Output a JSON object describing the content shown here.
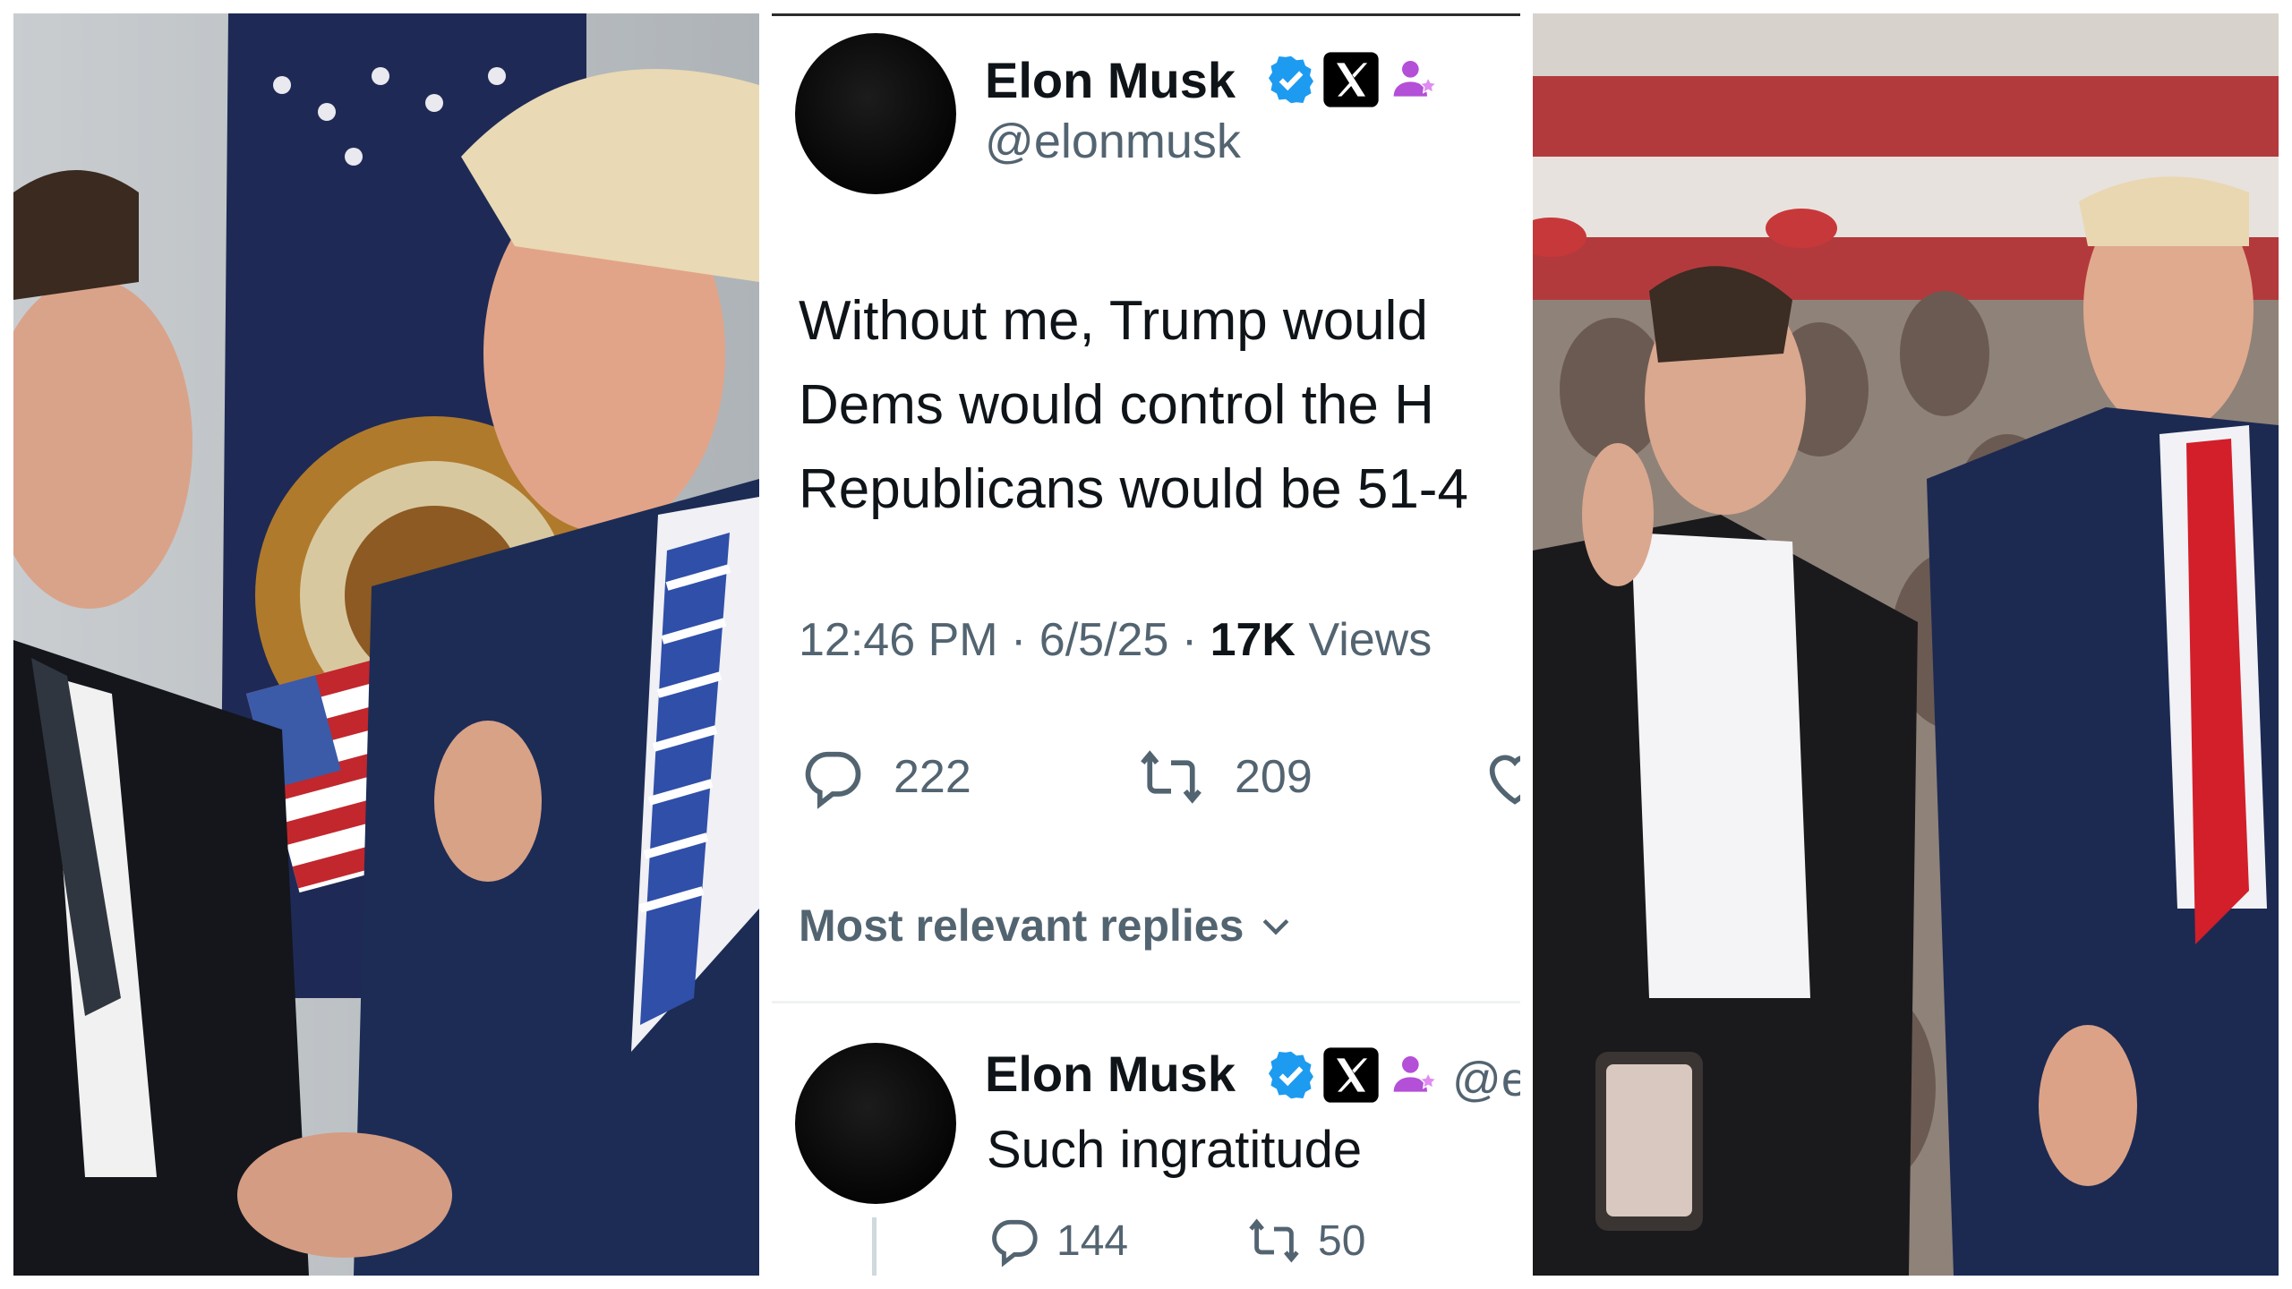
{
  "tweet": {
    "author_name": "Elon Musk",
    "author_handle": "@elonmusk",
    "text_lines": [
      "Without me, Trump would",
      "Dems would control the H",
      "Republicans would be 51-4"
    ],
    "time": "12:46 PM",
    "date": "6/5/25",
    "views_count": "17K",
    "views_label": "Views",
    "replies": "222",
    "reposts": "209",
    "sort_label": "Most relevant replies"
  },
  "reply": {
    "author_name": "Elon Musk",
    "author_handle": "@e",
    "text": "Such ingratitude",
    "replies": "144",
    "reposts": "50"
  },
  "colors": {
    "verified_blue": "#1d9bf0",
    "affiliate_purple": "#b44fd8",
    "text_primary": "#0f1419",
    "text_secondary": "#536471"
  },
  "icons": {
    "verified": "verified-badge-icon",
    "x_logo": "x-logo-icon",
    "affiliate": "affiliate-icon",
    "reply": "reply-icon",
    "repost": "repost-icon",
    "like": "like-icon",
    "chevron": "chevron-down-icon"
  }
}
